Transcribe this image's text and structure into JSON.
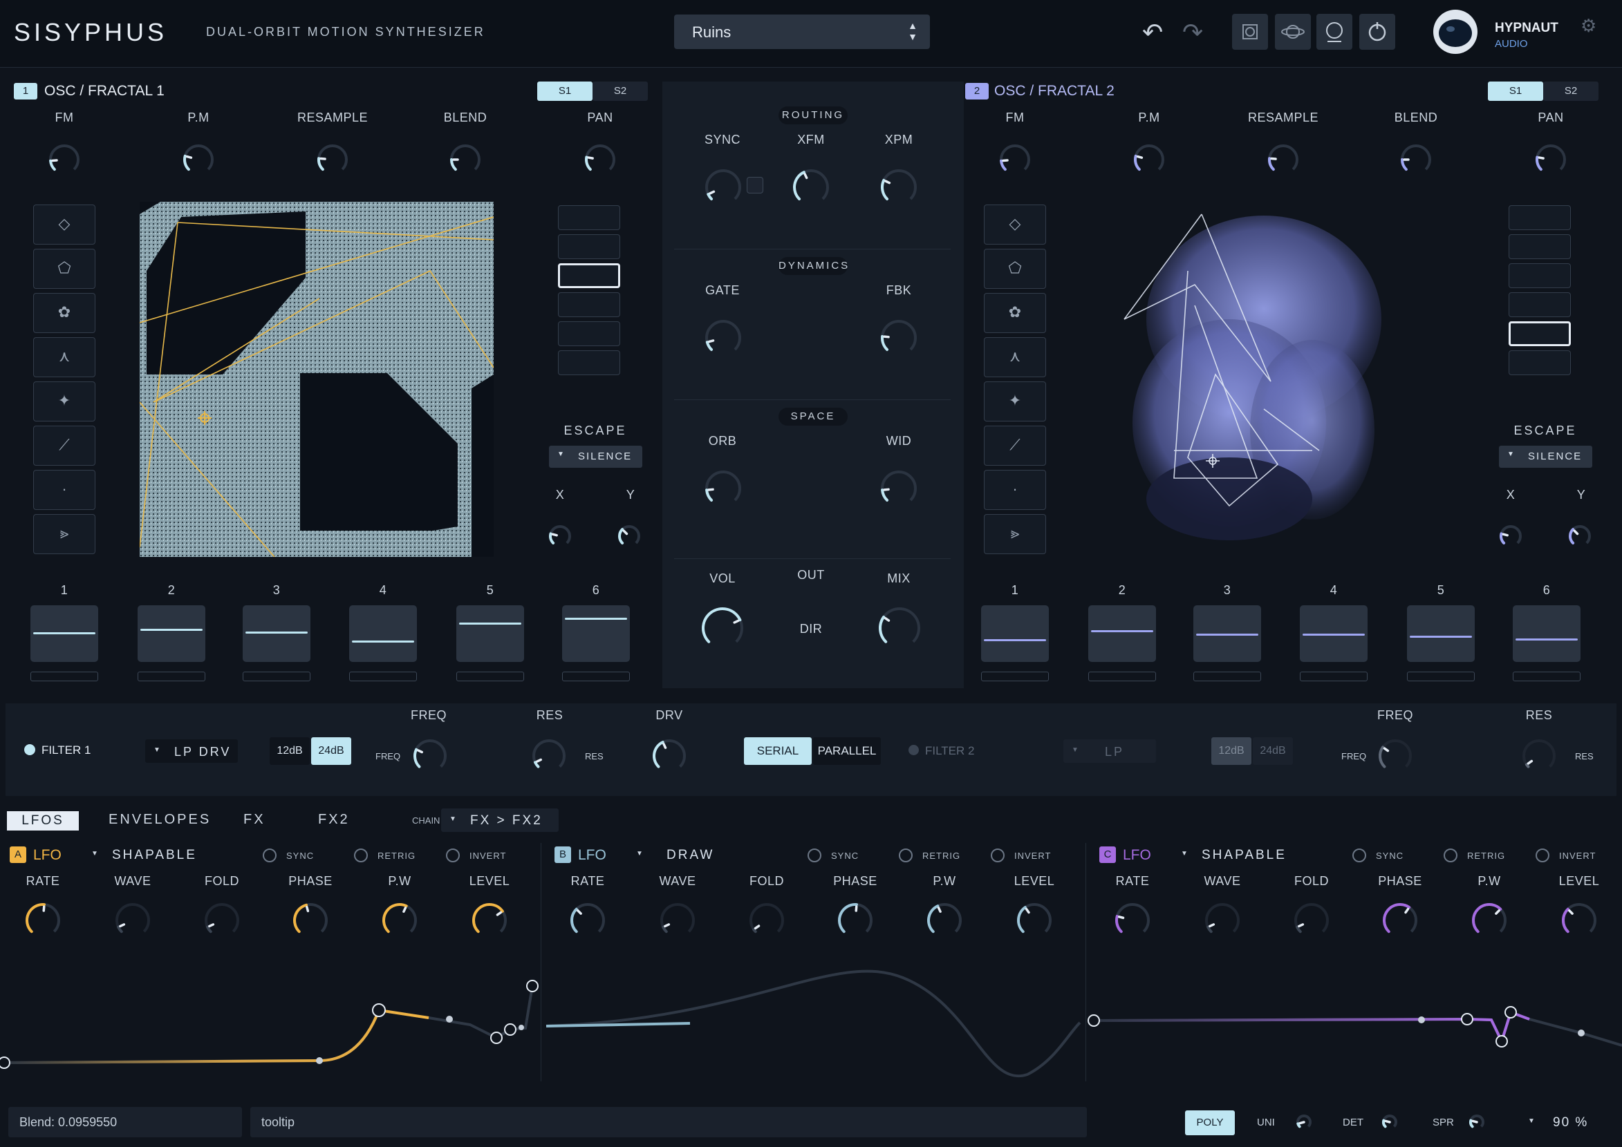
{
  "header": {
    "logo": "SISYPHUS",
    "subtitle": "DUAL-ORBIT MOTION SYNTHESIZER",
    "preset": "Ruins",
    "brand_top": "HYPNAUT",
    "brand_bottom": "AUDIO"
  },
  "osc1": {
    "index": "1",
    "title": "OSC / FRACTAL 1",
    "s1": "S1",
    "s2": "S2",
    "knob_labels": [
      "FM",
      "P.M",
      "RESAMPLE",
      "BLEND",
      "PAN"
    ],
    "escape_label": "ESCAPE",
    "escape_value": "SILENCE",
    "x_label": "X",
    "y_label": "Y",
    "slot_labels": [
      "1",
      "2",
      "3",
      "4",
      "5",
      "6"
    ]
  },
  "osc2": {
    "index": "2",
    "title": "OSC / FRACTAL 2",
    "s1": "S1",
    "s2": "S2",
    "knob_labels": [
      "FM",
      "P.M",
      "RESAMPLE",
      "BLEND",
      "PAN"
    ],
    "escape_label": "ESCAPE",
    "escape_value": "SILENCE",
    "x_label": "X",
    "y_label": "Y",
    "slot_labels": [
      "1",
      "2",
      "3",
      "4",
      "5",
      "6"
    ]
  },
  "center": {
    "routing": "ROUTING",
    "sync": "SYNC",
    "xfm": "XFM",
    "xpm": "XPM",
    "dynamics": "DYNAMICS",
    "gate": "GATE",
    "fbk": "FBK",
    "space": "SPACE",
    "orb": "ORB",
    "wid": "WID",
    "vol": "VOL",
    "out": "OUT",
    "dir": "DIR",
    "mix": "MIX"
  },
  "filter": {
    "f1_label": "FILTER 1",
    "f1_type": "LP DRV",
    "slope_12": "12dB",
    "slope_24": "24dB",
    "freq_head": "FREQ",
    "freq_side": "FREQ",
    "res_head": "RES",
    "res_side": "RES",
    "drv_head": "DRV",
    "serial": "SERIAL",
    "parallel": "PARALLEL",
    "f2_label": "FILTER 2",
    "f2_type": "LP",
    "f2_slope_12": "12dB",
    "f2_slope_24": "24dB",
    "f2_freq_head": "FREQ",
    "f2_freq_side": "FREQ",
    "f2_res_head": "RES",
    "f2_res_side": "RES"
  },
  "mod_tabs": {
    "tabs": [
      "LFOS",
      "ENVELOPES",
      "FX",
      "FX2"
    ],
    "chain_label": "CHAIN",
    "chain_value": "FX > FX2"
  },
  "lfos": [
    {
      "badge": "A",
      "name": "LFO",
      "mode": "SHAPABLE",
      "sync": "SYNC",
      "retrig": "RETRIG",
      "invert": "INVERT",
      "params": [
        "RATE",
        "WAVE",
        "FOLD",
        "PHASE",
        "P.W",
        "LEVEL"
      ],
      "color": "#f2b544"
    },
    {
      "badge": "B",
      "name": "LFO",
      "mode": "DRAW",
      "sync": "SYNC",
      "retrig": "RETRIG",
      "invert": "INVERT",
      "params": [
        "RATE",
        "WAVE",
        "FOLD",
        "PHASE",
        "P.W",
        "LEVEL"
      ],
      "color": "#9cc6da"
    },
    {
      "badge": "C",
      "name": "LFO",
      "mode": "SHAPABLE",
      "sync": "SYNC",
      "retrig": "RETRIG",
      "invert": "INVERT",
      "params": [
        "RATE",
        "WAVE",
        "FOLD",
        "PHASE",
        "P.W",
        "LEVEL"
      ],
      "color": "#a56be0"
    }
  ],
  "footer": {
    "status": "Blend: 0.0959550",
    "tooltip": "tooltip",
    "poly": "POLY",
    "uni": "UNI",
    "det": "DET",
    "spr": "SPR",
    "zoom": "90 %"
  },
  "colors": {
    "accent_light": "#bfe6f2",
    "osc2": "#9fa6f2",
    "lfo_a": "#f2b544",
    "lfo_c": "#a56be0"
  }
}
